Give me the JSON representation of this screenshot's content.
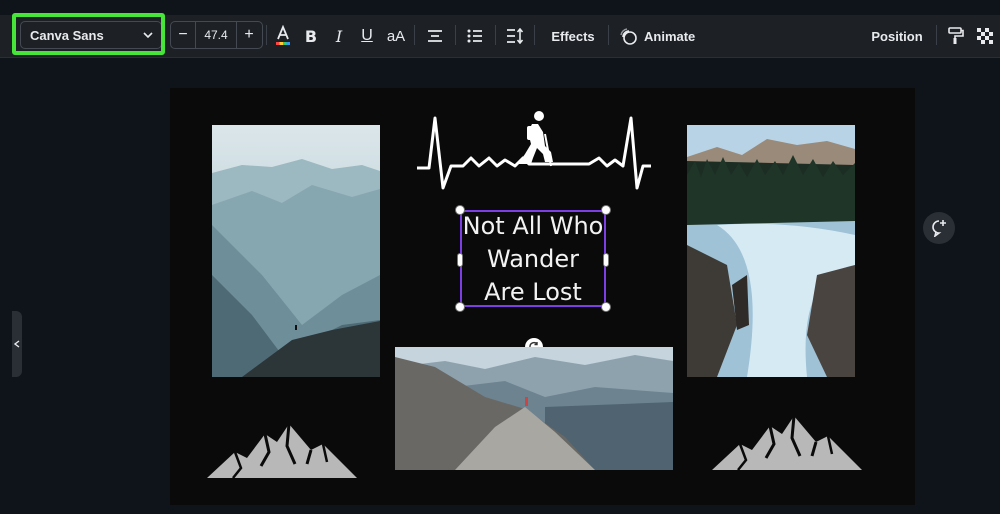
{
  "toolbar": {
    "font_family": "Canva Sans",
    "font_size": "47.4",
    "decrease_label": "−",
    "increase_label": "+",
    "bold_label": "B",
    "italic_label": "I",
    "underline_label": "U",
    "case_label": "aA",
    "effects_label": "Effects",
    "animate_label": "Animate",
    "position_label": "Position"
  },
  "design": {
    "text_lines": [
      "Not All Who",
      "Wander",
      "Are Lost"
    ]
  },
  "colors": {
    "highlight": "#47e53a",
    "selection": "#7b3fe4",
    "toolbar_bg": "#1d2126",
    "canvas_bg": "#0f141a"
  },
  "icons": [
    "chevron-down-icon",
    "text-color-icon",
    "align-center-icon",
    "list-icon",
    "spacing-icon",
    "animate-icon",
    "paint-roller-icon",
    "transparency-icon",
    "rotate-icon",
    "add-comment-icon",
    "chevron-left-icon"
  ]
}
